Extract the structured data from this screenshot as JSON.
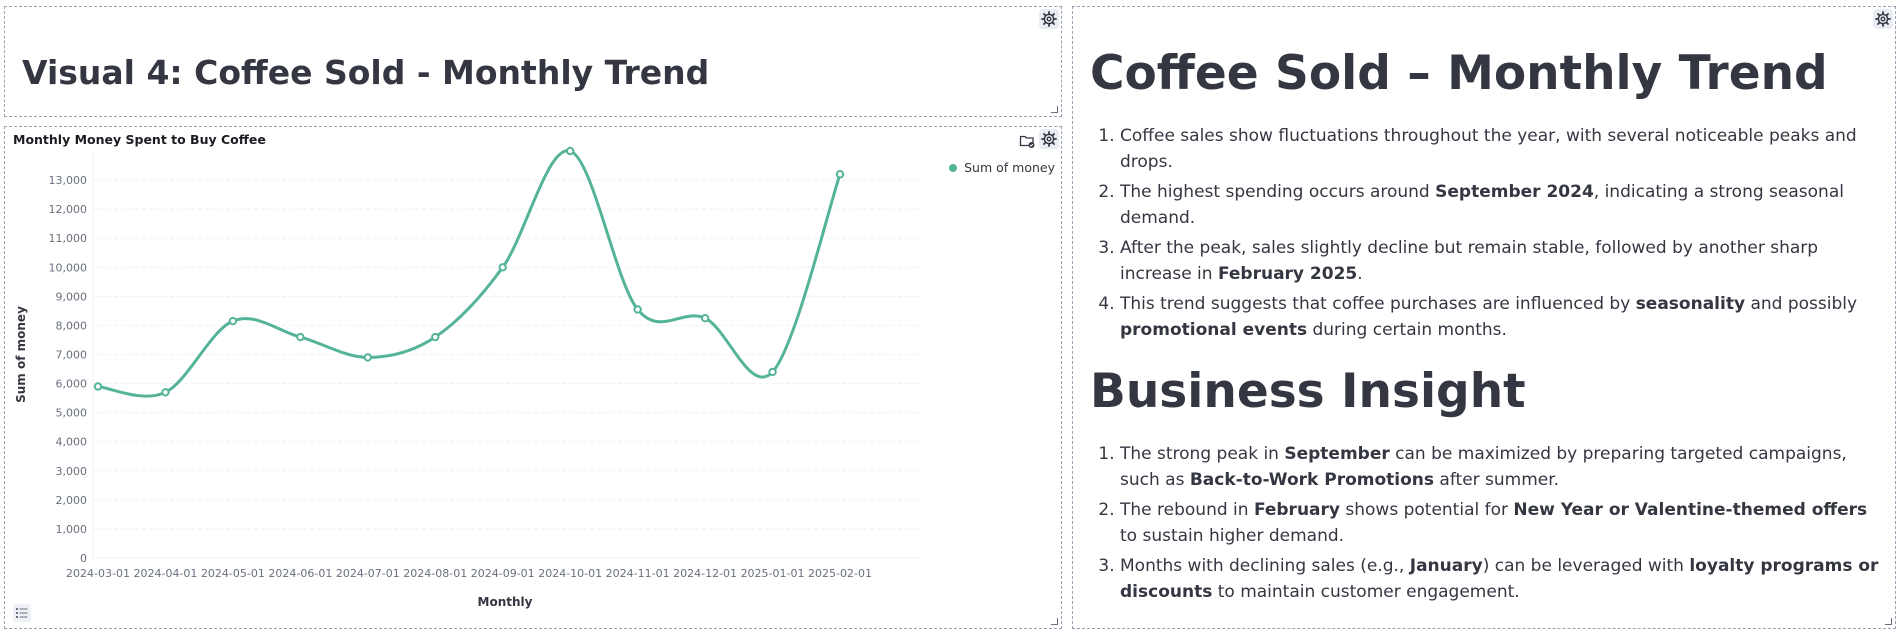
{
  "title_panel": {
    "title": "Visual 4: Coffee Sold - Monthly Trend"
  },
  "chart_panel": {
    "title": "Monthly Money Spent to Buy Coffee",
    "legend_label": "Sum of money"
  },
  "chart_data": {
    "type": "line",
    "title": "Monthly Money Spent to Buy Coffee",
    "xlabel": "Monthly",
    "ylabel": "Sum of money",
    "x": [
      "2024-03-01",
      "2024-04-01",
      "2024-05-01",
      "2024-06-01",
      "2024-07-01",
      "2024-08-01",
      "2024-09-01",
      "2024-10-01",
      "2024-11-01",
      "2024-12-01",
      "2025-01-01",
      "2025-02-01"
    ],
    "series": [
      {
        "name": "Sum of money",
        "values": [
          5900,
          5700,
          8150,
          7600,
          6900,
          7600,
          10000,
          14000,
          8550,
          8250,
          6400,
          13200
        ]
      }
    ],
    "yticks": [
      "0",
      "1,000",
      "2,000",
      "3,000",
      "4,000",
      "5,000",
      "6,000",
      "7,000",
      "8,000",
      "9,000",
      "10,000",
      "11,000",
      "12,000",
      "13,000"
    ],
    "ylim": [
      0,
      14000
    ],
    "grid": true,
    "legend": "top-right",
    "color": "#54b399"
  },
  "text_panel": {
    "heading1": "Coffee Sold – Monthly Trend",
    "trend_items": [
      {
        "parts": [
          {
            "t": "Coffee sales show fluctuations throughout the year, with several noticeable peaks and drops.",
            "b": false
          }
        ]
      },
      {
        "parts": [
          {
            "t": "The highest spending occurs around ",
            "b": false
          },
          {
            "t": "September 2024",
            "b": true
          },
          {
            "t": ", indicating a strong seasonal demand.",
            "b": false
          }
        ]
      },
      {
        "parts": [
          {
            "t": "After the peak, sales slightly decline but remain stable, followed by another sharp increase in ",
            "b": false
          },
          {
            "t": "February 2025",
            "b": true
          },
          {
            "t": ".",
            "b": false
          }
        ]
      },
      {
        "parts": [
          {
            "t": "This trend suggests that coffee purchases are influenced by ",
            "b": false
          },
          {
            "t": "seasonality",
            "b": true
          },
          {
            "t": " and possibly ",
            "b": false
          },
          {
            "t": "promotional events",
            "b": true
          },
          {
            "t": " during certain months.",
            "b": false
          }
        ]
      }
    ],
    "heading2": "Business Insight",
    "insight_items": [
      {
        "parts": [
          {
            "t": "The strong peak in ",
            "b": false
          },
          {
            "t": "September",
            "b": true
          },
          {
            "t": " can be maximized by preparing targeted campaigns, such as ",
            "b": false
          },
          {
            "t": "Back-to-Work Promotions",
            "b": true
          },
          {
            "t": " after summer.",
            "b": false
          }
        ]
      },
      {
        "parts": [
          {
            "t": "The rebound in ",
            "b": false
          },
          {
            "t": "February",
            "b": true
          },
          {
            "t": " shows potential for ",
            "b": false
          },
          {
            "t": "New Year or Valentine-themed offers",
            "b": true
          },
          {
            "t": " to sustain higher demand.",
            "b": false
          }
        ]
      },
      {
        "parts": [
          {
            "t": "Months with declining sales (e.g., ",
            "b": false
          },
          {
            "t": "January",
            "b": true
          },
          {
            "t": ") can be leveraged with ",
            "b": false
          },
          {
            "t": "loyalty programs or discounts",
            "b": true
          },
          {
            "t": " to maintain customer engagement.",
            "b": false
          }
        ]
      }
    ]
  },
  "icons": {
    "panel_settings": "gear-icon",
    "panel_resize": "resize-handle-icon",
    "chart_layer": "folder-check-icon",
    "legend_toggle": "list-icon"
  }
}
